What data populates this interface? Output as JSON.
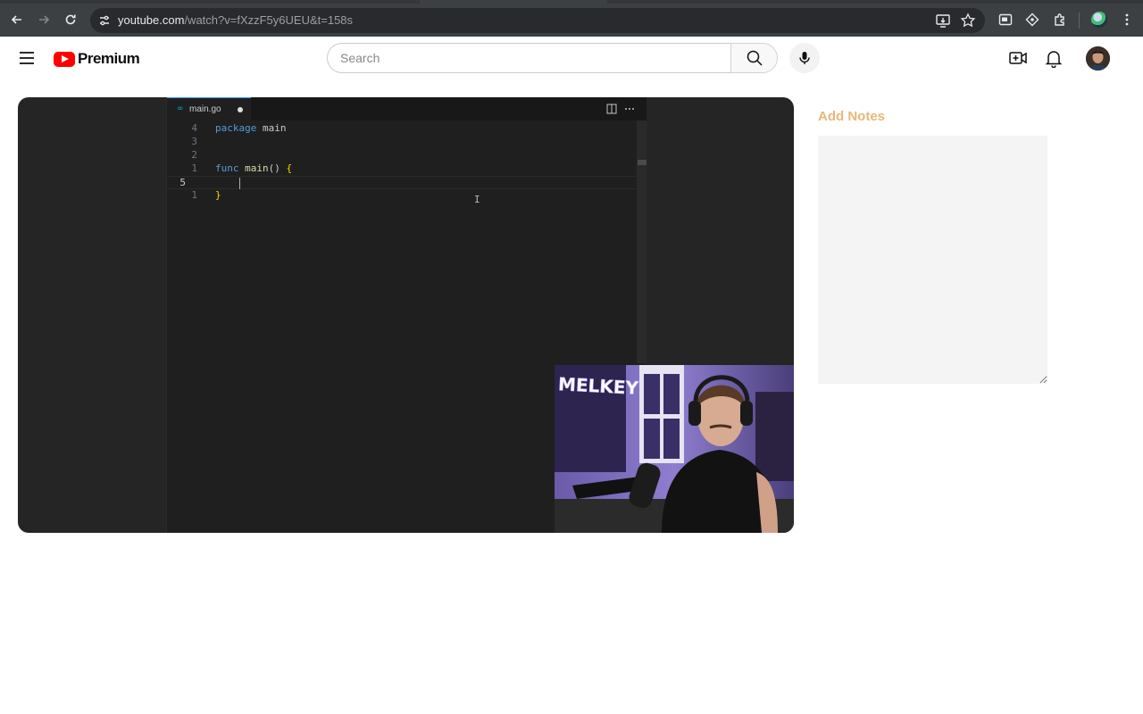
{
  "browser": {
    "url_host": "youtube.com",
    "url_path": "/watch?v=fXzzF5y6UEU&t=158s"
  },
  "header": {
    "logo_text": "Premium",
    "search_placeholder": "Search",
    "icons": [
      "menu-icon",
      "search-icon",
      "mic-icon",
      "create-icon",
      "bell-icon"
    ]
  },
  "editor": {
    "tab_label": "main.go",
    "tab_icon": "∞",
    "lines": [
      {
        "num": "4",
        "current": false,
        "tokens": [
          {
            "t": "package",
            "c": "kw"
          },
          {
            "t": " main",
            "c": ""
          }
        ]
      },
      {
        "num": "3",
        "current": false,
        "tokens": []
      },
      {
        "num": "2",
        "current": false,
        "tokens": []
      },
      {
        "num": "1",
        "current": false,
        "tokens": [
          {
            "t": "func",
            "c": "kw"
          },
          {
            "t": " ",
            "c": ""
          },
          {
            "t": "main",
            "c": "fn"
          },
          {
            "t": "() ",
            "c": ""
          },
          {
            "t": "{",
            "c": "br"
          }
        ]
      },
      {
        "num": "5",
        "current": true,
        "tokens": []
      },
      {
        "num": "1",
        "current": false,
        "tokens": [
          {
            "t": "}",
            "c": "br"
          }
        ]
      }
    ]
  },
  "webcam": {
    "sign_text": "MELKEY"
  },
  "notes": {
    "title": "Add Notes",
    "value": ""
  },
  "colors": {
    "youtube_red": "#ff0000",
    "notes_title": "#e8b77a",
    "editor_bg": "#1f1f1f",
    "go_keyword": "#569cd6"
  }
}
